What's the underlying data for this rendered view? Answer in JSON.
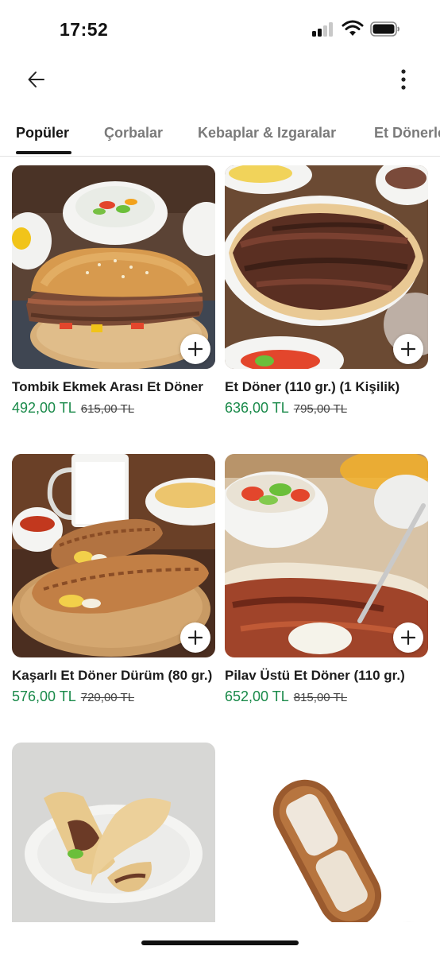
{
  "status_bar": {
    "time": "17:52"
  },
  "tabs": [
    {
      "label": "Popüler",
      "active": true
    },
    {
      "label": "Çorbalar",
      "active": false
    },
    {
      "label": "Kebaplar & Izgaralar",
      "active": false
    },
    {
      "label": "Et Dönerle",
      "active": false
    }
  ],
  "products": [
    {
      "name": "Tombik Ekmek Arası Et Döner",
      "price": "492,00 TL",
      "old_price": "615,00 TL"
    },
    {
      "name": "Et Döner (110 gr.) (1 Kişilik)",
      "price": "636,00 TL",
      "old_price": "795,00 TL"
    },
    {
      "name": "Kaşarlı Et Döner Dürüm (80 gr.)",
      "price": "576,00 TL",
      "old_price": "720,00 TL"
    },
    {
      "name": "Pilav Üstü Et Döner (110 gr.)",
      "price": "652,00 TL",
      "old_price": "815,00 TL"
    },
    {
      "name": "",
      "price": "",
      "old_price": ""
    },
    {
      "name": "",
      "price": "",
      "old_price": ""
    }
  ],
  "colors": {
    "price_green": "#1a8a4a",
    "active_tab": "#151515",
    "inactive_tab": "#7a7a7a"
  },
  "icons": [
    "back-arrow-icon",
    "more-vertical-icon",
    "plus-icon",
    "signal-icon",
    "wifi-icon",
    "battery-icon"
  ]
}
